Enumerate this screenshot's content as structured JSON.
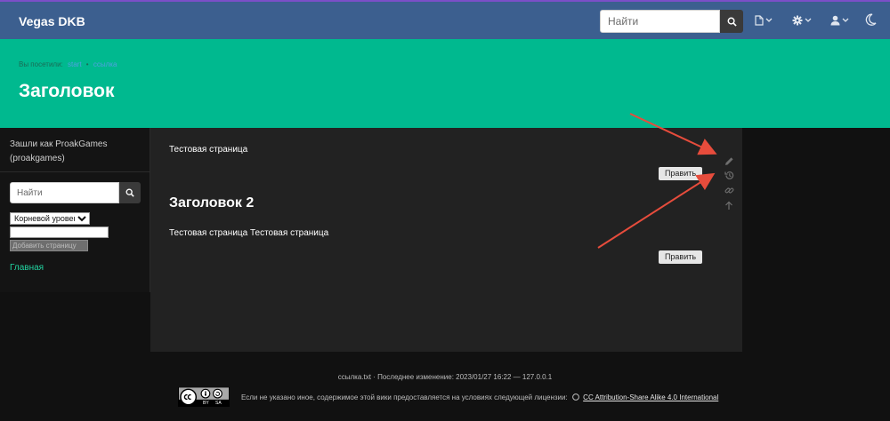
{
  "header": {
    "brand": "Vegas DKB",
    "search_placeholder": "Найти",
    "icons": [
      "file-icon",
      "gear-icon",
      "user-icon",
      "moon-icon"
    ]
  },
  "hero": {
    "breadcrumb_prefix": "Вы посетили:",
    "breadcrumb_items": [
      "start",
      "ссылка"
    ],
    "title": "Заголовок"
  },
  "sidebar": {
    "login_text": "Зашли как ProakGames (proakgames)",
    "search_placeholder": "Найти",
    "level_select": "Корневой уровень",
    "add_page_button": "Добавить страницу",
    "home_link": "Главная"
  },
  "content": {
    "paragraph_1": "Тестовая страница",
    "edit_button_1": "Править",
    "heading_2": "Заголовок 2",
    "paragraph_2": "Тестовая страница Тестовая страница",
    "edit_button_2": "Править"
  },
  "page_tools": [
    "pencil-icon",
    "history-icon",
    "link-icon",
    "arrow-up-icon"
  ],
  "footer": {
    "meta": "ссылка.txt · Последнее изменение: 2023/01/27 16:22 — 127.0.0.1",
    "license_text": "Если не указано иное, содержимое этой вики предоставляется на условиях следующей лицензии:",
    "license_link": "CC Attribution-Share Alike 4.0 International",
    "badge_by": "BY",
    "badge_sa": "SA"
  },
  "colors": {
    "topline": "#7b4fc7",
    "navbar": "#3c5f8f",
    "hero": "#00b98f",
    "link": "#22d3a0",
    "annotation_arrow": "#e74c3c"
  }
}
